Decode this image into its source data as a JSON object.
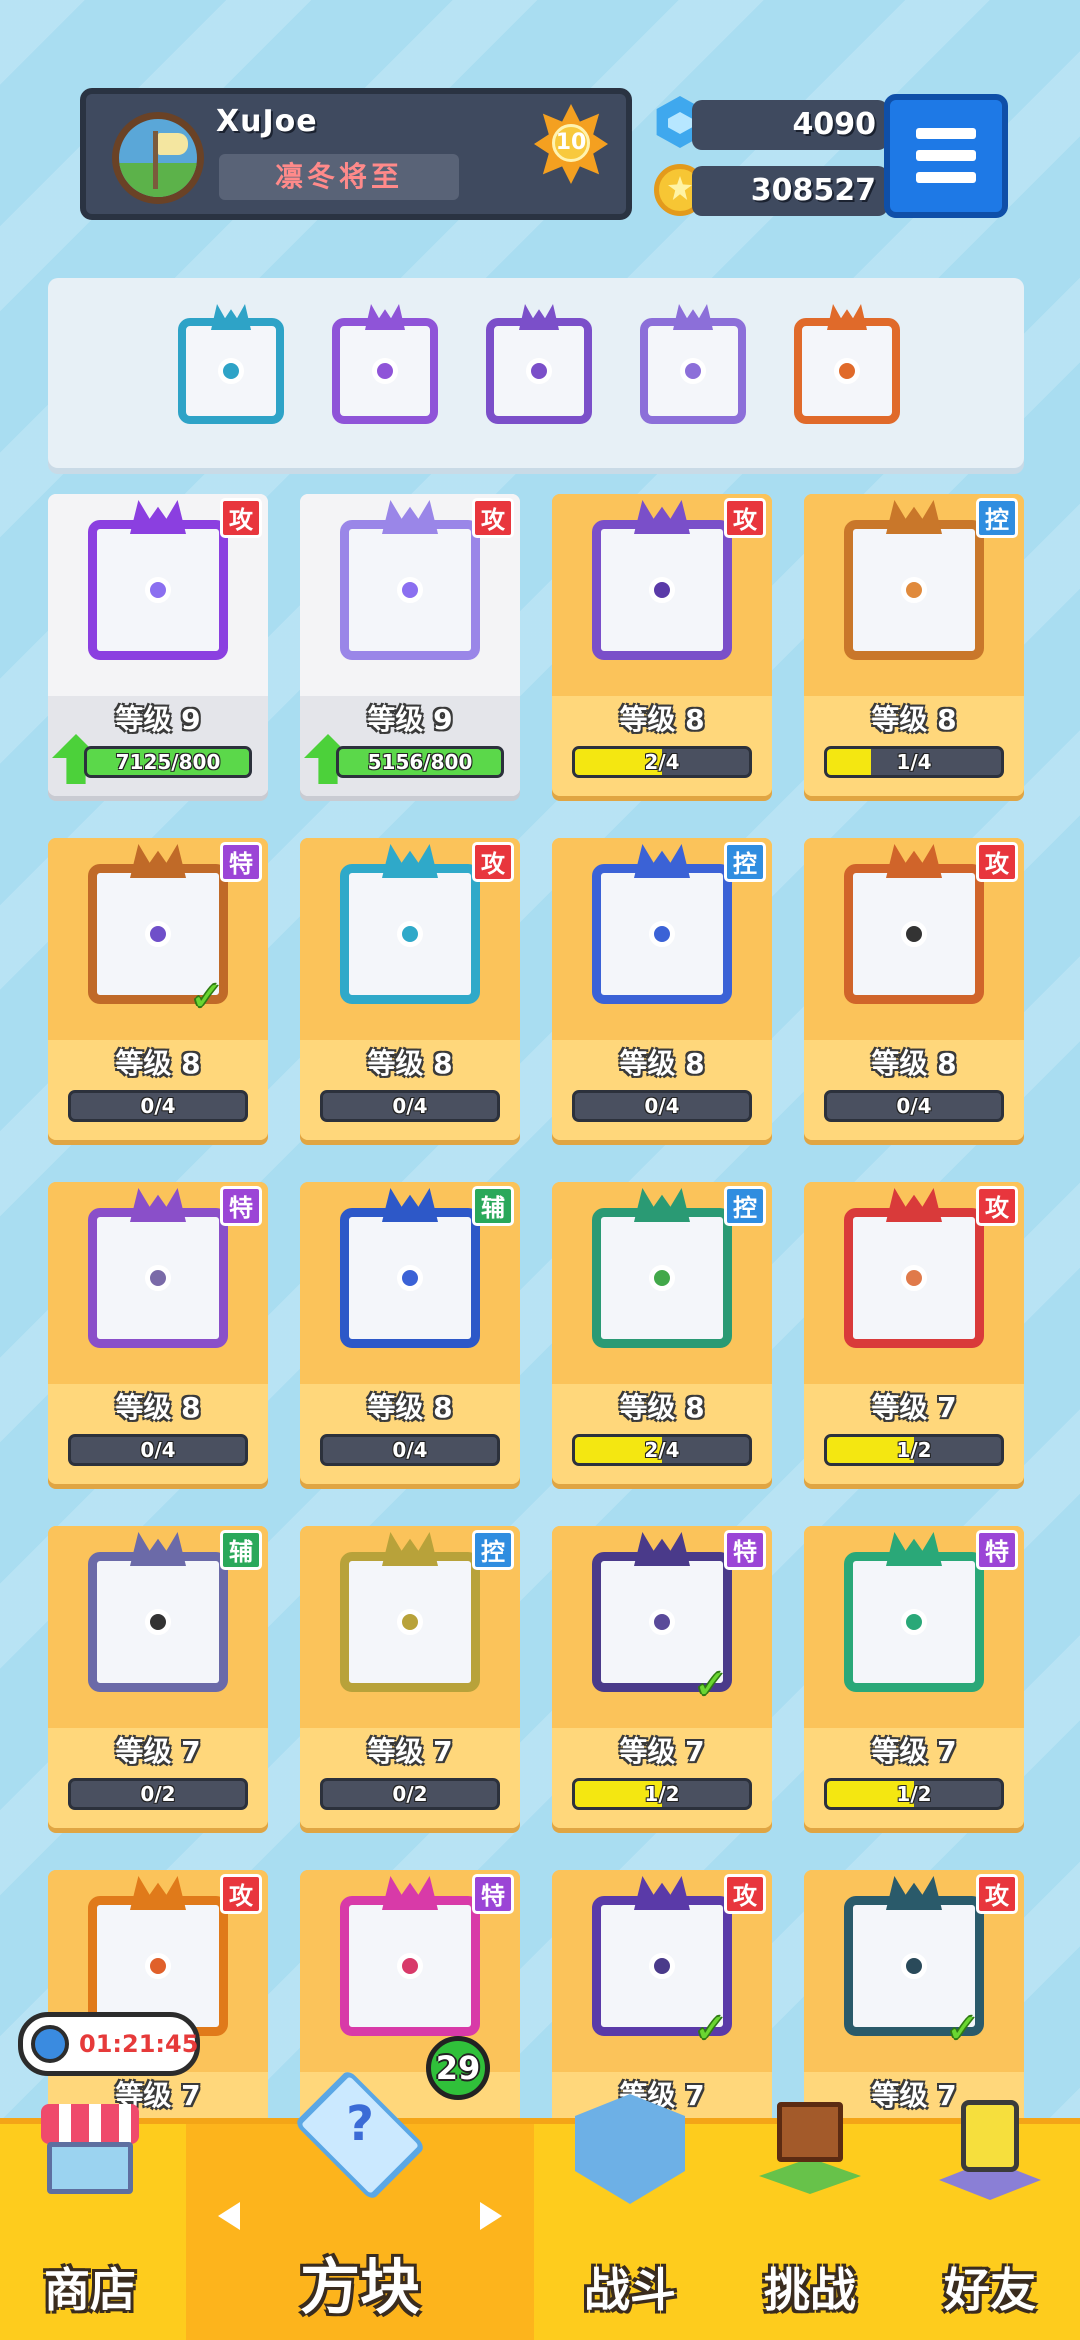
{
  "header": {
    "username": "XuJoe",
    "title": "凛冬将至",
    "level": "10",
    "gems": "4090",
    "coins": "308527"
  },
  "colors": {
    "attack": "#e8363d",
    "control": "#2f8de0",
    "special": "#9b45d6",
    "support": "#2aa85a",
    "progress_fill": "#f4e711",
    "progress_fill_ready": "#5bd84a"
  },
  "equipped": [
    {
      "name": "vortex",
      "color": "#2ea3c7"
    },
    {
      "name": "orbit",
      "color": "#8f54d8"
    },
    {
      "name": "eye",
      "color": "#7b4fc9"
    },
    {
      "name": "crack",
      "color": "#8c6fd9"
    },
    {
      "name": "infinity",
      "color": "#e06a2a"
    }
  ],
  "cards": [
    {
      "type": "攻",
      "tag": "gong",
      "level_text": "等级 9",
      "progress": "7125/800",
      "fill": 1.0,
      "ready": true,
      "white": true,
      "color": "#8b3fe0",
      "dot": "#8b6ff0",
      "checked": false
    },
    {
      "type": "攻",
      "tag": "gong",
      "level_text": "等级 9",
      "progress": "5156/800",
      "fill": 1.0,
      "ready": true,
      "white": true,
      "color": "#9a86e8",
      "dot": "#8b6ff0",
      "checked": false
    },
    {
      "type": "攻",
      "tag": "gong",
      "level_text": "等级 8",
      "progress": "2/4",
      "fill": 0.5,
      "ready": false,
      "white": false,
      "color": "#7a4fc9",
      "dot": "#5a3aa8",
      "checked": false
    },
    {
      "type": "控",
      "tag": "kong",
      "level_text": "等级 8",
      "progress": "1/4",
      "fill": 0.25,
      "ready": false,
      "white": false,
      "color": "#c9772a",
      "dot": "#e08a3c",
      "checked": false
    },
    {
      "type": "特",
      "tag": "te",
      "level_text": "等级 8",
      "progress": "0/4",
      "fill": 0,
      "ready": false,
      "white": false,
      "color": "#c06a28",
      "dot": "#6f4fc9",
      "checked": true
    },
    {
      "type": "攻",
      "tag": "gong",
      "level_text": "等级 8",
      "progress": "0/4",
      "fill": 0,
      "ready": false,
      "white": false,
      "color": "#2fa9c9",
      "dot": "#2fa9c9",
      "checked": false
    },
    {
      "type": "控",
      "tag": "kong",
      "level_text": "等级 8",
      "progress": "0/4",
      "fill": 0,
      "ready": false,
      "white": false,
      "color": "#3b62d6",
      "dot": "#3b62d6",
      "checked": false
    },
    {
      "type": "攻",
      "tag": "gong",
      "level_text": "等级 8",
      "progress": "0/4",
      "fill": 0,
      "ready": false,
      "white": false,
      "color": "#d0642a",
      "dot": "#333333",
      "checked": false
    },
    {
      "type": "特",
      "tag": "te",
      "level_text": "等级 8",
      "progress": "0/4",
      "fill": 0,
      "ready": false,
      "white": false,
      "color": "#8a4fc9",
      "dot": "#7a6aa8",
      "checked": false
    },
    {
      "type": "辅",
      "tag": "fu",
      "level_text": "等级 8",
      "progress": "0/4",
      "fill": 0,
      "ready": false,
      "white": false,
      "color": "#2d58c8",
      "dot": "#3b62d6",
      "checked": false
    },
    {
      "type": "控",
      "tag": "kong",
      "level_text": "等级 8",
      "progress": "2/4",
      "fill": 0.5,
      "ready": false,
      "white": false,
      "color": "#2a9a74",
      "dot": "#42a84a",
      "checked": false
    },
    {
      "type": "攻",
      "tag": "gong",
      "level_text": "等级 7",
      "progress": "1/2",
      "fill": 0.5,
      "ready": false,
      "white": false,
      "color": "#d93a3a",
      "dot": "#e07a4a",
      "checked": false
    },
    {
      "type": "辅",
      "tag": "fu",
      "level_text": "等级 7",
      "progress": "0/2",
      "fill": 0,
      "ready": false,
      "white": false,
      "color": "#6b6aa8",
      "dot": "#333333",
      "checked": false
    },
    {
      "type": "控",
      "tag": "kong",
      "level_text": "等级 7",
      "progress": "0/2",
      "fill": 0,
      "ready": false,
      "white": false,
      "color": "#b8a23a",
      "dot": "#b8a23a",
      "checked": false
    },
    {
      "type": "特",
      "tag": "te",
      "level_text": "等级 7",
      "progress": "1/2",
      "fill": 0.5,
      "ready": false,
      "white": false,
      "color": "#4a3a8a",
      "dot": "#5a4a9a",
      "checked": true
    },
    {
      "type": "特",
      "tag": "te",
      "level_text": "等级 7",
      "progress": "1/2",
      "fill": 0.5,
      "ready": false,
      "white": false,
      "color": "#2aa878",
      "dot": "#2aa878",
      "checked": false
    },
    {
      "type": "攻",
      "tag": "gong",
      "level_text": "等级 7",
      "progress": "",
      "fill": 0,
      "ready": false,
      "white": false,
      "color": "#e07a1a",
      "dot": "#e0602a",
      "checked": false
    },
    {
      "type": "特",
      "tag": "te",
      "level_text": "",
      "progress": "",
      "fill": 0,
      "ready": false,
      "white": false,
      "color": "#d83aa8",
      "dot": "#d83a6a",
      "checked": false
    },
    {
      "type": "攻",
      "tag": "gong",
      "level_text": "等级 7",
      "progress": "",
      "fill": 0,
      "ready": false,
      "white": false,
      "color": "#5a3aa8",
      "dot": "#4a3a8a",
      "checked": true
    },
    {
      "type": "攻",
      "tag": "gong",
      "level_text": "等级 7",
      "progress": "",
      "fill": 0,
      "ready": false,
      "white": false,
      "color": "#2a5a6a",
      "dot": "#2a4a5a",
      "checked": true
    }
  ],
  "timer": "01:21:45",
  "cube_badge": "29",
  "nav": {
    "shop": "商店",
    "blocks": "方块",
    "battle": "战斗",
    "challenge": "挑战",
    "friends": "好友"
  }
}
